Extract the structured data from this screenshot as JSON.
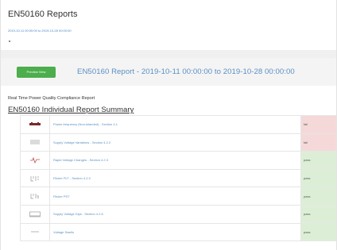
{
  "header": {
    "title": "EN50160 Reports",
    "date_link": "2019-10-11 00:00:00 to 2019-10-28 00:00:00"
  },
  "report_bar": {
    "preview_button_label": "Preview View",
    "heading": "EN50160 Report - 2019-10-11 00:00:00 to 2019-10-28 00:00:00"
  },
  "subtitle": "Real Time Power Quality Compliance Report",
  "summary": {
    "title": "EN50160 Individual Report Summary",
    "rows": [
      {
        "icon": "frequency-icon",
        "name": "Power frequency (Non-islanded) - Section 4.1",
        "result": "fail",
        "color": "#f5d9d9"
      },
      {
        "icon": "voltage-variation-icon",
        "name": "Supply Voltage Variations - Section 4.2.2",
        "result": "fail",
        "color": "#f5d9d9"
      },
      {
        "icon": "rapid-voltage-change-icon",
        "name": "Rapid Voltage Changes - Section 4.2.3",
        "result": "pass",
        "color": "#dcefd6"
      },
      {
        "icon": "flicker-icon",
        "name": "Flicker PLT - Section 4.2.3",
        "result": "pass",
        "color": "#dcefd6"
      },
      {
        "icon": "flicker-pst-icon",
        "name": "Flicker PST",
        "result": "pass",
        "color": "#dcefd6"
      },
      {
        "icon": "voltage-dip-icon",
        "name": "Supply Voltage Dips - Section 4.2.6",
        "result": "pass",
        "color": "#dcefd6"
      },
      {
        "icon": "voltage-swell-icon",
        "name": "Voltage Swells",
        "result": "pass",
        "color": "#dcefd6"
      }
    ]
  }
}
